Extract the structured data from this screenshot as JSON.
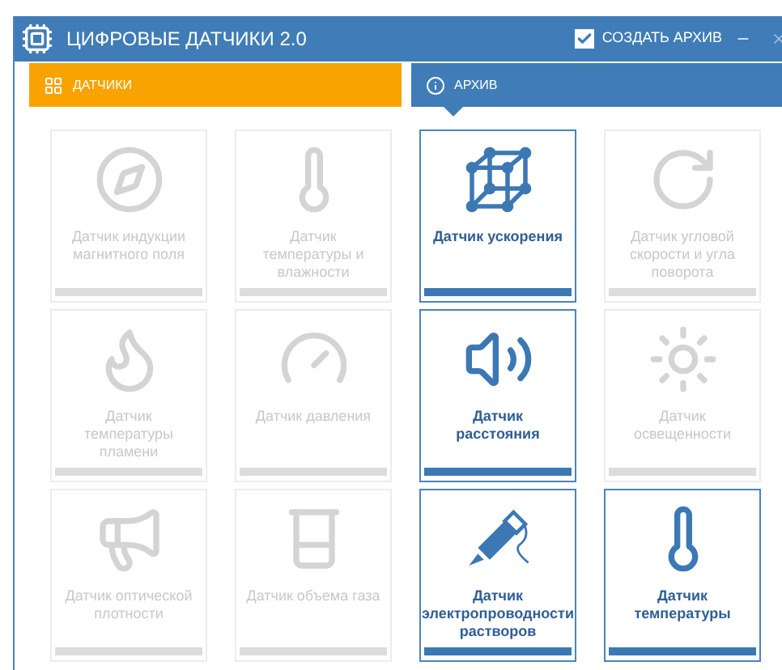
{
  "window": {
    "title": "ЦИФРОВЫЕ ДАТЧИКИ 2.0"
  },
  "archive_option": {
    "label": "СОЗДАТЬ АРХИВ",
    "checked": true
  },
  "tabs": [
    {
      "label": "ДАТЧИКИ",
      "selected": true
    },
    {
      "label": "АРХИВ",
      "selected": false
    }
  ],
  "sensors": [
    {
      "label": "Датчик индукции магнитного поля",
      "enabled": false
    },
    {
      "label": "Датчик температуры и влажности",
      "enabled": false
    },
    {
      "label": "Датчик ускорения",
      "enabled": true
    },
    {
      "label": "Датчик угловой скорости и угла поворота",
      "enabled": false
    },
    {
      "label": "Датчик температуры пламени",
      "enabled": false
    },
    {
      "label": "Датчик давления",
      "enabled": false
    },
    {
      "label": "Датчик расстояния",
      "enabled": true
    },
    {
      "label": "Датчик освещенности",
      "enabled": false
    },
    {
      "label": "Датчик оптической плотности",
      "enabled": false
    },
    {
      "label": "Датчик объема газа",
      "enabled": false
    },
    {
      "label": "Датчик электропроводности растворов",
      "enabled": true
    },
    {
      "label": "Датчик температуры",
      "enabled": true
    }
  ]
}
